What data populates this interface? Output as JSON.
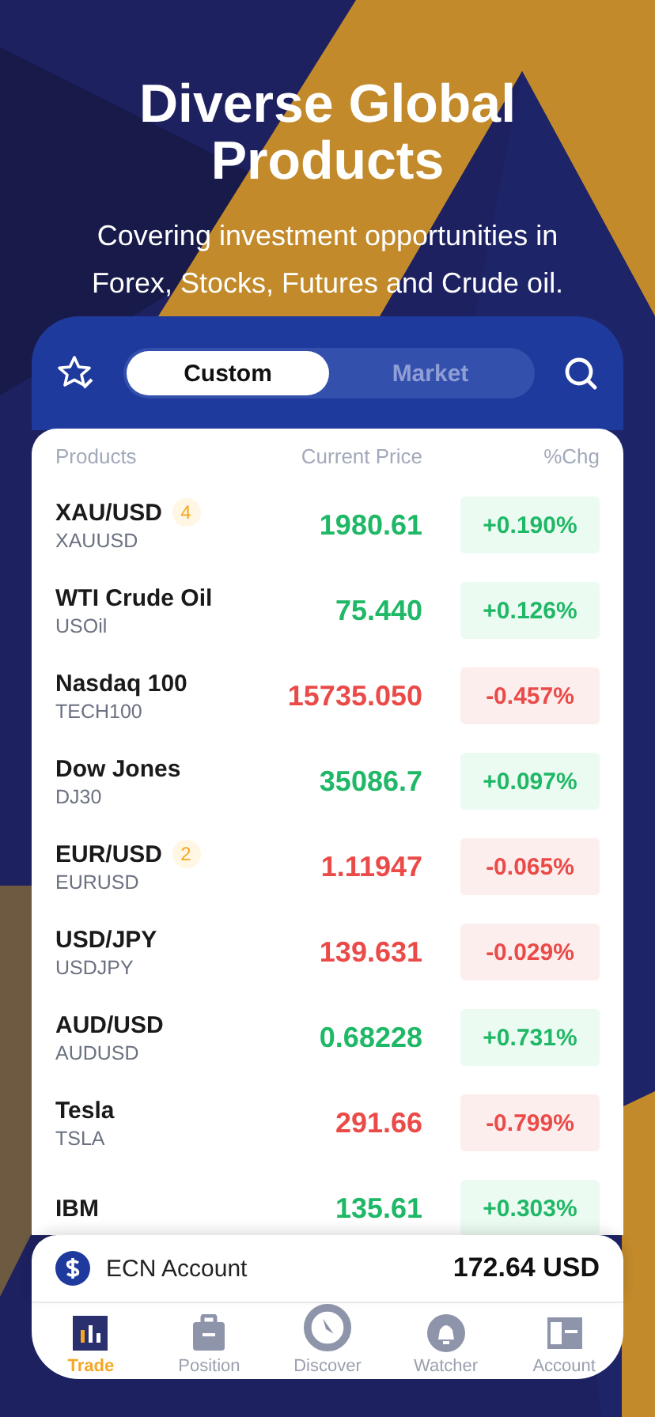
{
  "promo": {
    "title": "Diverse Global Products",
    "subtitle": "Covering investment opportunities in Forex, Stocks, Futures and Crude oil."
  },
  "segments": [
    {
      "label": "Custom",
      "selected": true
    },
    {
      "label": "Market",
      "selected": false
    }
  ],
  "columns": [
    "Products",
    "Current Price",
    "%Chg"
  ],
  "rows": [
    {
      "name": "XAU/USD",
      "badge": "4",
      "symbol": "XAUUSD",
      "price": "1980.61",
      "change": "+0.190%",
      "kind": "up"
    },
    {
      "name": "WTI Crude Oil",
      "symbol": "USOil",
      "price": "75.440",
      "change": "+0.126%",
      "kind": "up"
    },
    {
      "name": "Nasdaq 100",
      "symbol": "TECH100",
      "price": "15735.050",
      "change": "-0.457%",
      "kind": "down"
    },
    {
      "name": "Dow Jones",
      "symbol": "DJ30",
      "price": "35086.7",
      "change": "+0.097%",
      "kind": "up"
    },
    {
      "name": "EUR/USD",
      "badge": "2",
      "symbol": "EURUSD",
      "price": "1.11947",
      "change": "-0.065%",
      "kind": "down"
    },
    {
      "name": "USD/JPY",
      "symbol": "USDJPY",
      "price": "139.631",
      "change": "-0.029%",
      "kind": "down"
    },
    {
      "name": "AUD/USD",
      "symbol": "AUDUSD",
      "price": "0.68228",
      "change": "+0.731%",
      "kind": "up"
    },
    {
      "name": "Tesla",
      "symbol": "TSLA",
      "price": "291.66",
      "change": "-0.799%",
      "kind": "down"
    },
    {
      "name": "IBM",
      "price": "135.61",
      "change": "+0.303%",
      "kind": "up"
    }
  ],
  "account": {
    "name": "ECN Account",
    "balance": "172.64 USD"
  },
  "nav": [
    {
      "label": "Trade",
      "kind": "chart",
      "selected": true
    },
    {
      "label": "Position",
      "kind": "briefcase",
      "selected": false
    },
    {
      "label": "Discover",
      "kind": "compass",
      "selected": false
    },
    {
      "label": "Watcher",
      "kind": "bell",
      "selected": false
    },
    {
      "label": "Account",
      "kind": "wallet",
      "selected": false
    }
  ]
}
